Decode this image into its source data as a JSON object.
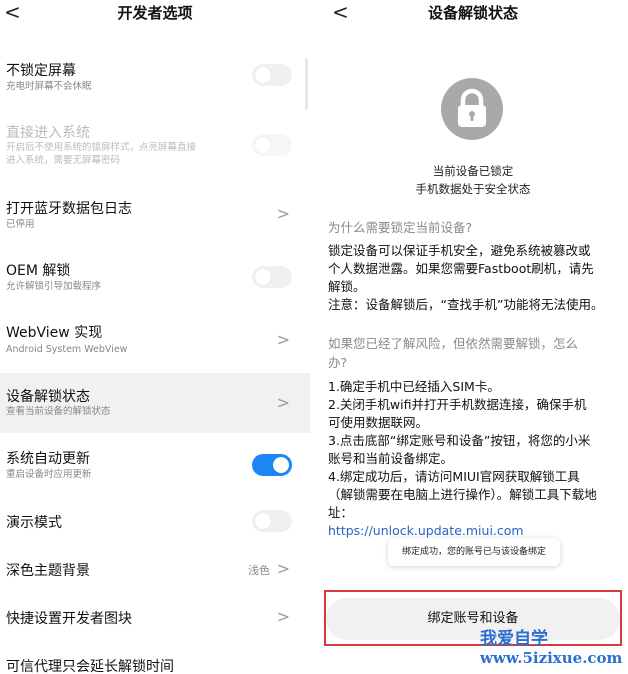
{
  "left": {
    "back": "<",
    "title": "开发者选项",
    "items": [
      {
        "title": "不锁定屏幕",
        "sub": "充电时屏幕不会休眠"
      },
      {
        "title": "直接进入系统",
        "sub1": "开启后不使用系统的锁屏样式，点亮屏幕直接",
        "sub2": "进入系统，需要无屏幕密码"
      },
      {
        "title": "打开蓝牙数据包日志",
        "sub": "已停用"
      },
      {
        "title": "OEM 解锁",
        "sub": "允许解锁引导加载程序"
      },
      {
        "title": "WebView 实现",
        "sub": "Android System WebView"
      },
      {
        "title": "设备解锁状态",
        "sub": "查看当前设备的解锁状态"
      },
      {
        "title": "系统自动更新",
        "sub": "重启设备时应用更新"
      },
      {
        "title": "演示模式"
      },
      {
        "title": "深色主题背景",
        "value": "浅色"
      },
      {
        "title": "快捷设置开发者图块"
      },
      {
        "title": "可信代理只会延长解锁时间"
      }
    ],
    "chevron": ">"
  },
  "right": {
    "back": "<",
    "title": "设备解锁状态",
    "status_line1": "当前设备已锁定",
    "status_line2": "手机数据处于安全状态",
    "q1": "为什么需要锁定当前设备?",
    "a1_lines": [
      "锁定设备可以保证手机安全，避免系统被篡改或",
      "个人数据泄露。如果您需要Fastboot刷机，请先",
      "解锁。",
      "注意：设备解锁后，“查找手机”功能将无法使用。"
    ],
    "q2_lines": [
      "如果您已经了解风险，但依然需要解锁，怎么",
      "办?"
    ],
    "steps_lines": [
      "1.确定手机中已经插入SIM卡。",
      "2.关闭手机wifi并打开手机数据连接，确保手机",
      "可使用数据联网。",
      "3.点击底部“绑定账号和设备”按钮，将您的小米",
      "账号和当前设备绑定。",
      "4.绑定成功后，请访问MIUI官网获取解锁工具",
      "（解锁需要在电脑上进行操作）。解锁工具下载地",
      "址："
    ],
    "link_text": "https://unlock.update.miui.com",
    "toast": "绑定成功，您的账号已与该设备绑定",
    "bind_button": "绑定账号和设备"
  },
  "watermark": {
    "line1": "我爱自学",
    "line2": "www.5izixue.com"
  },
  "colors": {
    "accent": "#1a87f5",
    "highlight_border": "#d63b3b",
    "watermark": "#2b6fd1",
    "lock_bg": "#a9a9a9"
  },
  "icons": {
    "lock": "padlock-icon",
    "back": "chevron-left-icon",
    "chevron": "chevron-right-icon"
  }
}
